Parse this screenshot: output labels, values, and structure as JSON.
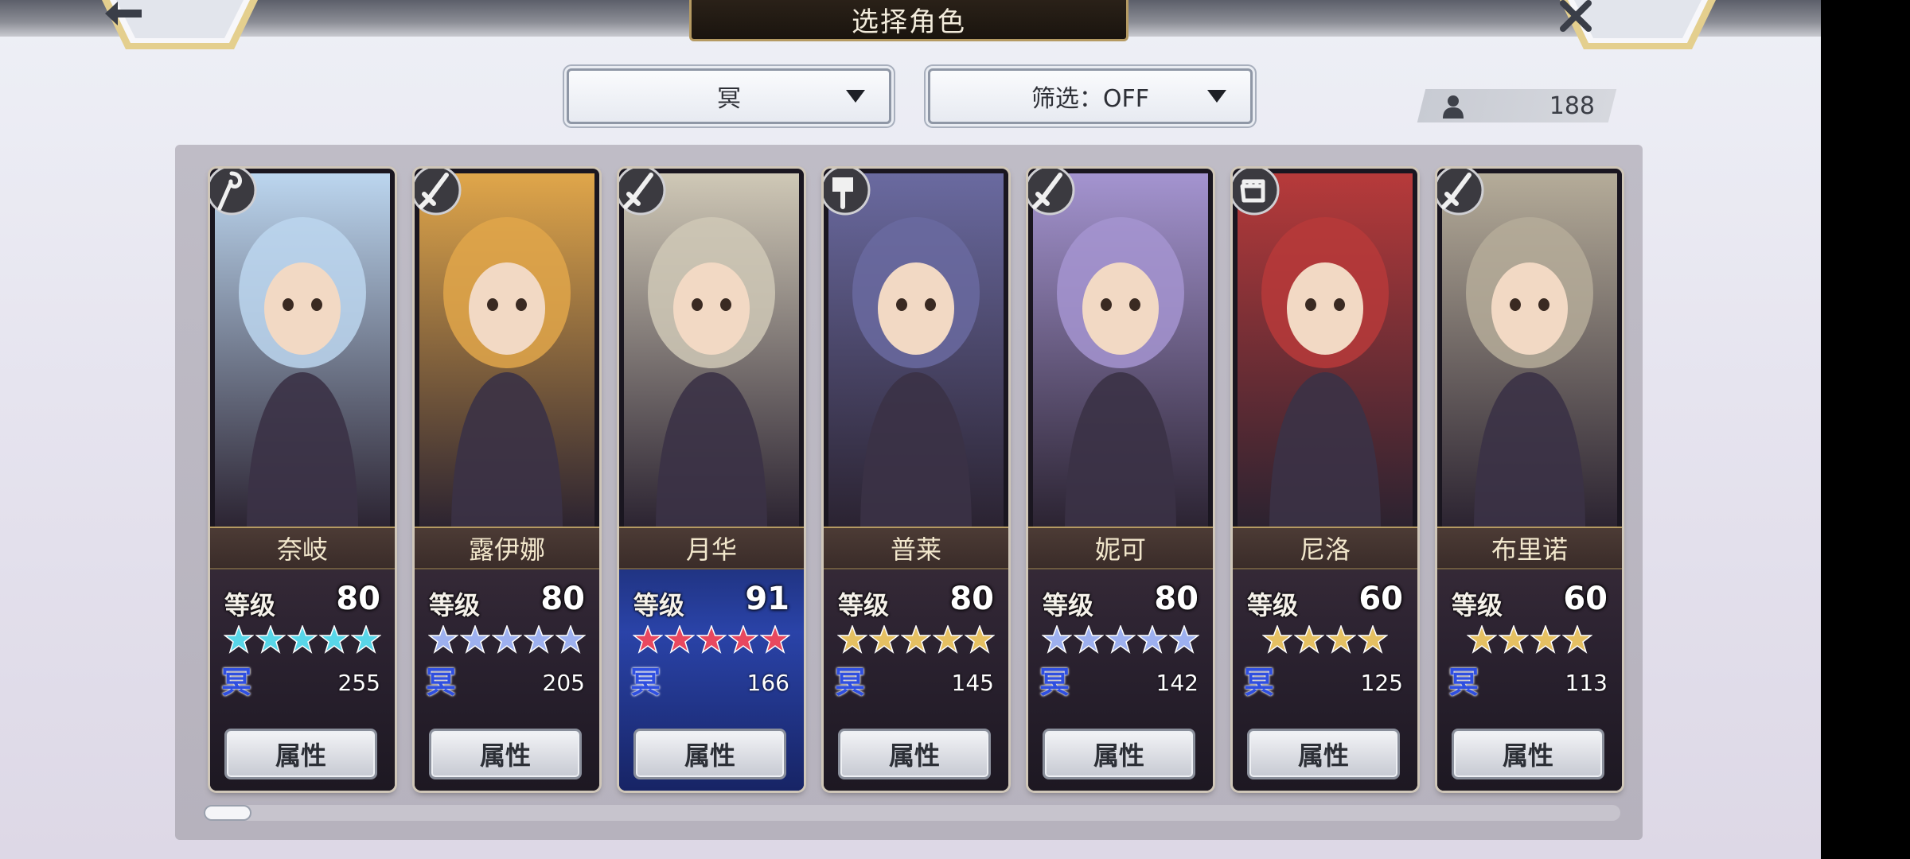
{
  "screen": {
    "title": "选择角色"
  },
  "topbar": {
    "back_icon": "left-arrow-icon",
    "close_icon": "close-x-icon"
  },
  "filters": {
    "element_value": "冥",
    "filter_value": "筛选：OFF"
  },
  "roster": {
    "count": "188"
  },
  "characters": [
    {
      "name": "奈岐",
      "level_label": "等级",
      "level": "80",
      "stars": 5,
      "star_color": "#58d6e8",
      "element": "冥",
      "power": "255",
      "button": "属性",
      "weapon": "staff-icon",
      "theme": "#bcd6ef"
    },
    {
      "name": "露伊娜",
      "level_label": "等级",
      "level": "80",
      "stars": 5,
      "star_color": "#9db0ef",
      "element": "冥",
      "power": "205",
      "button": "属性",
      "weapon": "sword-icon",
      "theme": "#e0a64a"
    },
    {
      "name": "月华",
      "level_label": "等级",
      "level": "91",
      "stars": 5,
      "star_color": "#e8485f",
      "element": "冥",
      "power": "166",
      "button": "属性",
      "weapon": "sword-icon",
      "theme": "#cfc8b6"
    },
    {
      "name": "普莱",
      "level_label": "等级",
      "level": "80",
      "stars": 5,
      "star_color": "#e5c062",
      "element": "冥",
      "power": "145",
      "button": "属性",
      "weapon": "hammer-icon",
      "theme": "#6a6aa0"
    },
    {
      "name": "妮可",
      "level_label": "等级",
      "level": "80",
      "stars": 5,
      "star_color": "#9db0ef",
      "element": "冥",
      "power": "142",
      "button": "属性",
      "weapon": "sword-icon",
      "theme": "#a494d0"
    },
    {
      "name": "尼洛",
      "level_label": "等级",
      "level": "60",
      "stars": 4,
      "star_color": "#e5c062",
      "element": "冥",
      "power": "125",
      "button": "属性",
      "weapon": "fist-icon",
      "theme": "#b73a3a"
    },
    {
      "name": "布里诺",
      "level_label": "等级",
      "level": "60",
      "stars": 4,
      "star_color": "#e5c062",
      "element": "冥",
      "power": "113",
      "button": "属性",
      "weapon": "sword-icon",
      "theme": "#b5ac99"
    }
  ],
  "selected_index": 2
}
